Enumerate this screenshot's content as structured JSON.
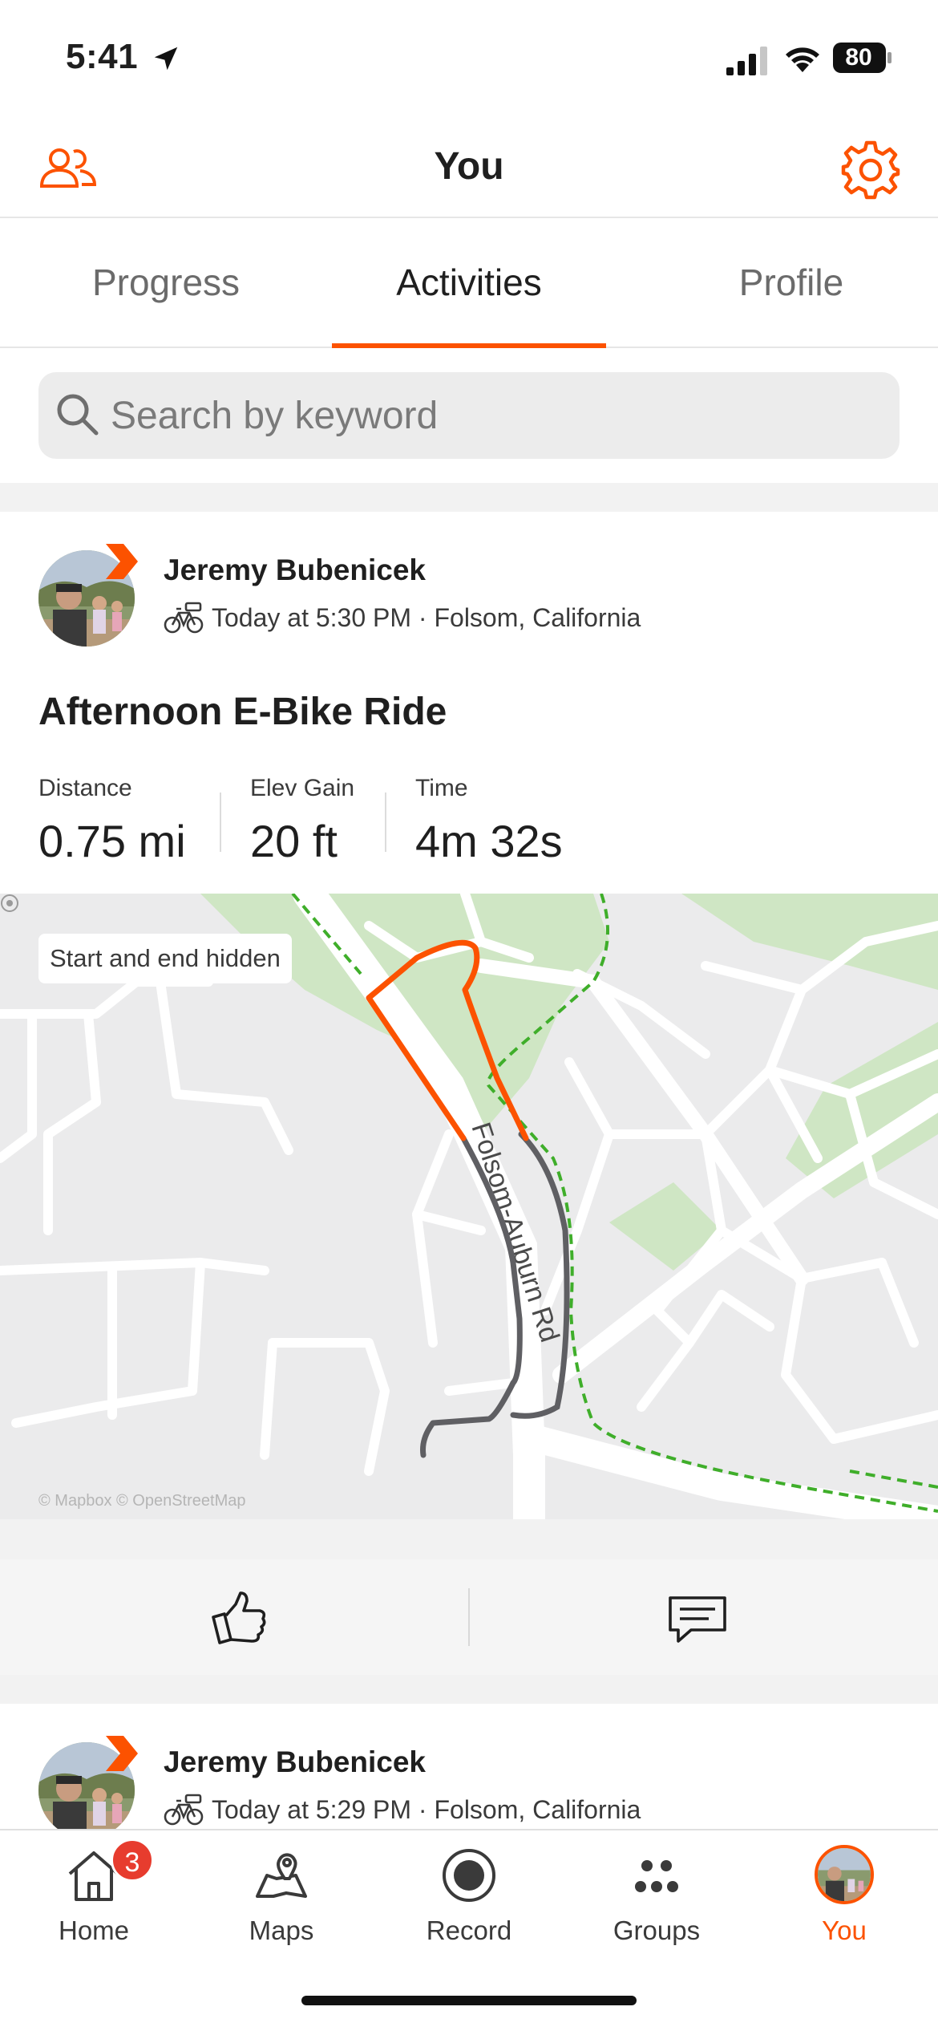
{
  "status_bar": {
    "time": "5:41",
    "battery": "80"
  },
  "header": {
    "title": "You"
  },
  "tabs": [
    {
      "label": "Progress",
      "active": false
    },
    {
      "label": "Activities",
      "active": true
    },
    {
      "label": "Profile",
      "active": false
    }
  ],
  "search": {
    "placeholder": "Search by keyword",
    "value": ""
  },
  "activities": [
    {
      "athlete": "Jeremy Bubenicek",
      "meta": "Today at 5:30 PM · Folsom, California",
      "title": "Afternoon E-Bike Ride",
      "stats": [
        {
          "label": "Distance",
          "value": "0.75 mi"
        },
        {
          "label": "Elev Gain",
          "value": "20 ft"
        },
        {
          "label": "Time",
          "value": "4m 32s"
        }
      ],
      "map": {
        "privacy_label": "Start and end hidden",
        "road_label": "Folsom-Auburn Rd",
        "attribution": "© Mapbox © OpenStreetMap",
        "route_color": "#fc5200",
        "hidden_route_color": "#5f5f63",
        "trail_color": "#3fae2a"
      }
    },
    {
      "athlete": "Jeremy Bubenicek",
      "meta": "Today at 5:29 PM · Folsom, California"
    }
  ],
  "tab_bar": {
    "items": [
      {
        "label": "Home",
        "icon": "home-icon",
        "badge": "3"
      },
      {
        "label": "Maps",
        "icon": "maps-icon"
      },
      {
        "label": "Record",
        "icon": "record-icon"
      },
      {
        "label": "Groups",
        "icon": "groups-icon"
      },
      {
        "label": "You",
        "icon": "avatar",
        "active": true
      }
    ]
  },
  "colors": {
    "accent": "#fc5200",
    "badge": "#e73c2e"
  }
}
